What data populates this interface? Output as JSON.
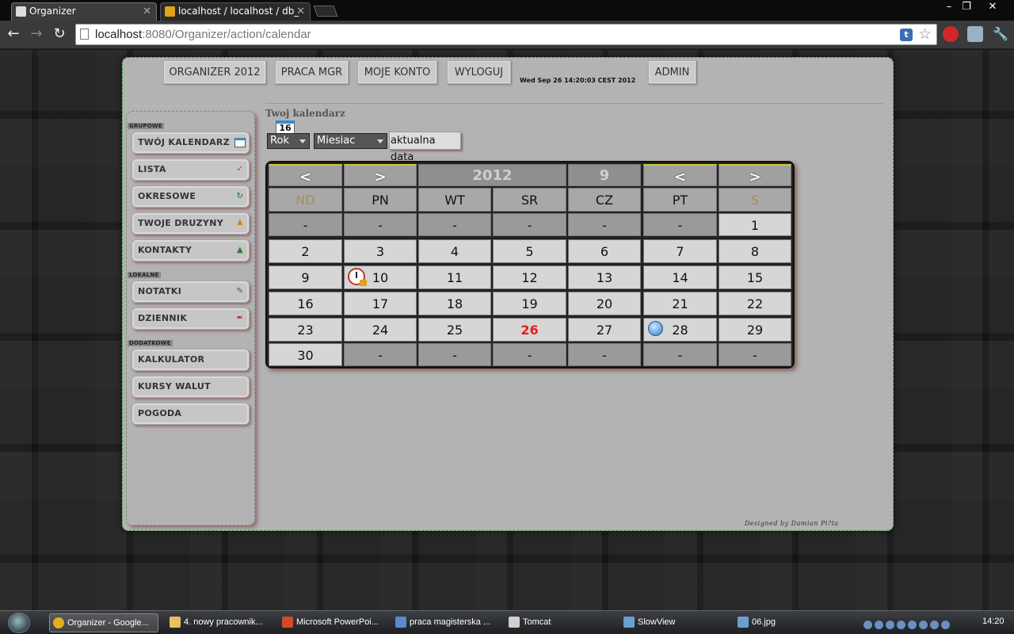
{
  "browser": {
    "tabs": [
      {
        "title": "Organizer",
        "active": true
      },
      {
        "title": "localhost / localhost / db_",
        "active": false
      }
    ],
    "window_controls": [
      "–",
      "❐",
      "✕"
    ],
    "url_host": "localhost",
    "url_rest": ":8080/Organizer/action/calendar"
  },
  "topnav": {
    "buttons": [
      "ORGANIZER 2012",
      "PRACA MGR",
      "MOJE KONTO",
      "WYLOGUJ",
      "ADMIN"
    ],
    "datetime": "Wed Sep 26 14:20:03 CEST 2012"
  },
  "sidebar": {
    "sections": [
      {
        "title": "GRUPOWE",
        "items": [
          {
            "label": "TWÓJ KALENDARZ",
            "icon": "calendar-icon"
          },
          {
            "label": "LISTA",
            "icon": "checklist-icon"
          },
          {
            "label": "OKRESOWE",
            "icon": "recurring-icon"
          },
          {
            "label": "TWOJE DRUZYNY",
            "icon": "team-icon"
          },
          {
            "label": "KONTAKTY",
            "icon": "contacts-icon"
          }
        ]
      },
      {
        "title": "LOKALNE",
        "items": [
          {
            "label": "NOTATKI",
            "icon": "notes-icon"
          },
          {
            "label": "DZIENNIK",
            "icon": "journal-icon"
          }
        ]
      },
      {
        "title": "DODATKOWE",
        "items": [
          {
            "label": "KALKULATOR",
            "icon": ""
          },
          {
            "label": "KURSY WALUT",
            "icon": ""
          },
          {
            "label": "POGODA",
            "icon": ""
          }
        ]
      }
    ]
  },
  "content": {
    "title": "Twoj kalendarz",
    "calendar_icon_day": "16",
    "year_select": "Rok",
    "month_select": "Miesiac",
    "current_date_button": "aktualna data"
  },
  "calendar": {
    "prev": "<",
    "next": ">",
    "year": "2012",
    "month": "9",
    "weekdays": [
      "ND",
      "PN",
      "WT",
      "SR",
      "CZ",
      "PT",
      "S"
    ],
    "weeks": [
      [
        "-",
        "-",
        "-",
        "-",
        "-",
        "-",
        "1"
      ],
      [
        "2",
        "3",
        "4",
        "5",
        "6",
        "7",
        "8"
      ],
      [
        "9",
        "10",
        "11",
        "12",
        "13",
        "14",
        "15"
      ],
      [
        "16",
        "17",
        "18",
        "19",
        "20",
        "21",
        "22"
      ],
      [
        "23",
        "24",
        "25",
        "26",
        "27",
        "28",
        "29"
      ],
      [
        "30",
        "-",
        "-",
        "-",
        "-",
        "-",
        "-"
      ]
    ],
    "today": "26",
    "event_days": {
      "10": "alarm-clock-icon",
      "28": "info-icon"
    }
  },
  "footer": {
    "credit": "Designed by Damian Pi?ta"
  },
  "taskbar": {
    "items": [
      {
        "label": "Organizer - Google...",
        "active": true,
        "color": "#e0b020"
      },
      {
        "label": "4. nowy pracownik...",
        "active": false,
        "color": "#e8c060"
      },
      {
        "label": "Microsoft PowerPoi...",
        "active": false,
        "color": "#d24a2a"
      },
      {
        "label": "praca magisterska ...",
        "active": false,
        "color": "#5a8ad0"
      },
      {
        "label": "Tomcat",
        "active": false,
        "color": "#cfcfcf"
      },
      {
        "label": "SlowView",
        "active": false,
        "color": "#6aa0d0"
      },
      {
        "label": "06.jpg",
        "active": false,
        "color": "#6aa0d0"
      }
    ],
    "clock": "14:20"
  }
}
